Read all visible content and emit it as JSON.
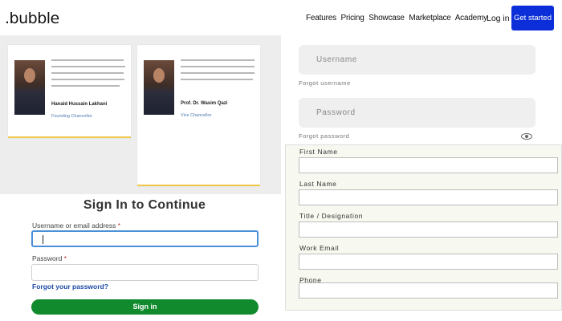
{
  "brand": {
    "logo": ".bubble"
  },
  "nav": {
    "items": [
      "Features",
      "Pricing",
      "Showcase",
      "Marketplace",
      "Academy"
    ],
    "login": "Log in",
    "get_started": "Get started"
  },
  "testimonials": [
    {
      "name": "Hanaid Hussain Lakhani",
      "role": "Founding Chancellor"
    },
    {
      "name": "Prof. Dr. Wasim Qazi",
      "role": "Vice Chancellor"
    }
  ],
  "signin": {
    "title": "Sign In to Continue",
    "username_label": "Username or email address",
    "password_label": "Password",
    "required_mark": "*",
    "forgot_password": "Forgot your password?",
    "button": "Sign in"
  },
  "credentials": {
    "username_placeholder": "Username",
    "forgot_username": "Forgot username",
    "password_placeholder": "Password",
    "forgot_password": "Forgot password"
  },
  "registration": {
    "fields": [
      "First Name",
      "Last Name",
      "Title / Designation",
      "Work Email",
      "Phone"
    ]
  }
}
